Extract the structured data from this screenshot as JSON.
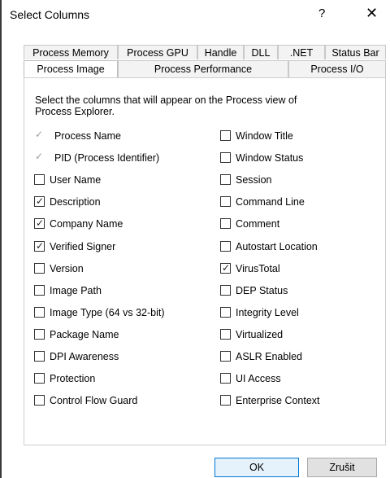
{
  "window": {
    "title": "Select Columns",
    "help": "?",
    "close": "✕"
  },
  "tabs_row1": [
    "Process Memory",
    "Process GPU",
    "Handle",
    "DLL",
    ".NET",
    "Status Bar"
  ],
  "tabs_row2": [
    "Process Image",
    "Process Performance",
    "Process I/O"
  ],
  "active_tab": "Process Image",
  "instructions": "Select the columns that will appear on the Process view of Process Explorer.",
  "left_column": [
    {
      "label": "Process Name",
      "checked": true,
      "disabled": true
    },
    {
      "label": "PID (Process Identifier)",
      "checked": true,
      "disabled": true
    },
    {
      "label": "User Name",
      "checked": false
    },
    {
      "label": "Description",
      "checked": true
    },
    {
      "label": "Company Name",
      "checked": true
    },
    {
      "label": "Verified Signer",
      "checked": true
    },
    {
      "label": "Version",
      "checked": false
    },
    {
      "label": "Image Path",
      "checked": false
    },
    {
      "label": "Image Type (64 vs 32-bit)",
      "checked": false
    },
    {
      "label": "Package Name",
      "checked": false
    },
    {
      "label": "DPI Awareness",
      "checked": false
    },
    {
      "label": "Protection",
      "checked": false
    },
    {
      "label": "Control Flow Guard",
      "checked": false
    }
  ],
  "right_column": [
    {
      "label": "Window Title",
      "checked": false
    },
    {
      "label": "Window Status",
      "checked": false
    },
    {
      "label": "Session",
      "checked": false
    },
    {
      "label": "Command Line",
      "checked": false
    },
    {
      "label": "Comment",
      "checked": false
    },
    {
      "label": "Autostart Location",
      "checked": false
    },
    {
      "label": "VirusTotal",
      "checked": true
    },
    {
      "label": "DEP Status",
      "checked": false
    },
    {
      "label": "Integrity Level",
      "checked": false
    },
    {
      "label": "Virtualized",
      "checked": false
    },
    {
      "label": "ASLR Enabled",
      "checked": false
    },
    {
      "label": "UI Access",
      "checked": false
    },
    {
      "label": "Enterprise Context",
      "checked": false
    }
  ],
  "buttons": {
    "ok": "OK",
    "cancel": "Zrušit"
  }
}
